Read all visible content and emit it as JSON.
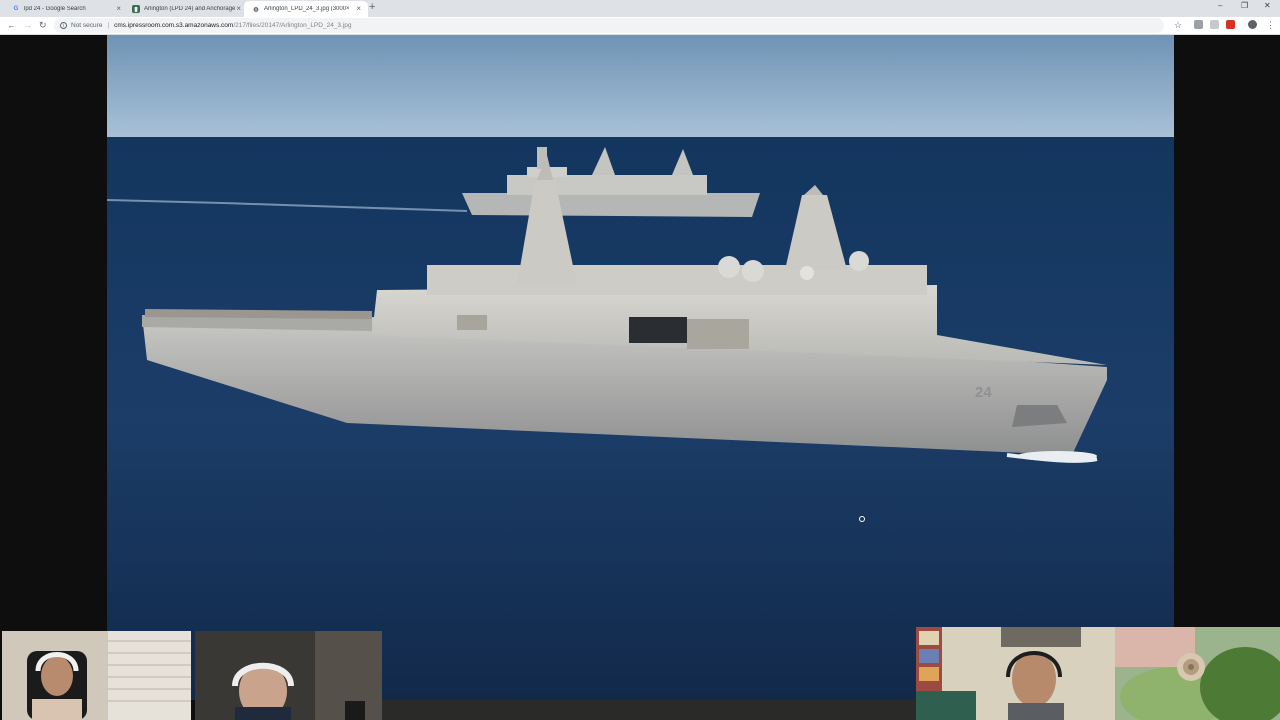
{
  "browser": {
    "tabs": [
      {
        "title": "lpd 24 - Google Search",
        "favicon": "google-icon",
        "active": false
      },
      {
        "title": "Arlington (LPD 24) and Anchorage",
        "favicon": "site-icon",
        "active": false
      },
      {
        "title": "Arlington_LPD_24_3.jpg (3000×",
        "favicon": "globe-icon",
        "active": true
      }
    ],
    "new_tab": "+",
    "address": {
      "security_label": "Not secure",
      "host": "cms.ipressroom.com.s3.amazonaws.com",
      "path": "/217/files/20147/Arlington_LPD_24_3.jpg"
    },
    "window_controls": {
      "minimize": "–",
      "restore": "❐",
      "close": "✕"
    }
  },
  "image": {
    "hull_number": "24"
  },
  "colors": {
    "tabstrip": "#dee1e6",
    "sea": "#1b3a66",
    "sky": "#8fb2cf"
  }
}
